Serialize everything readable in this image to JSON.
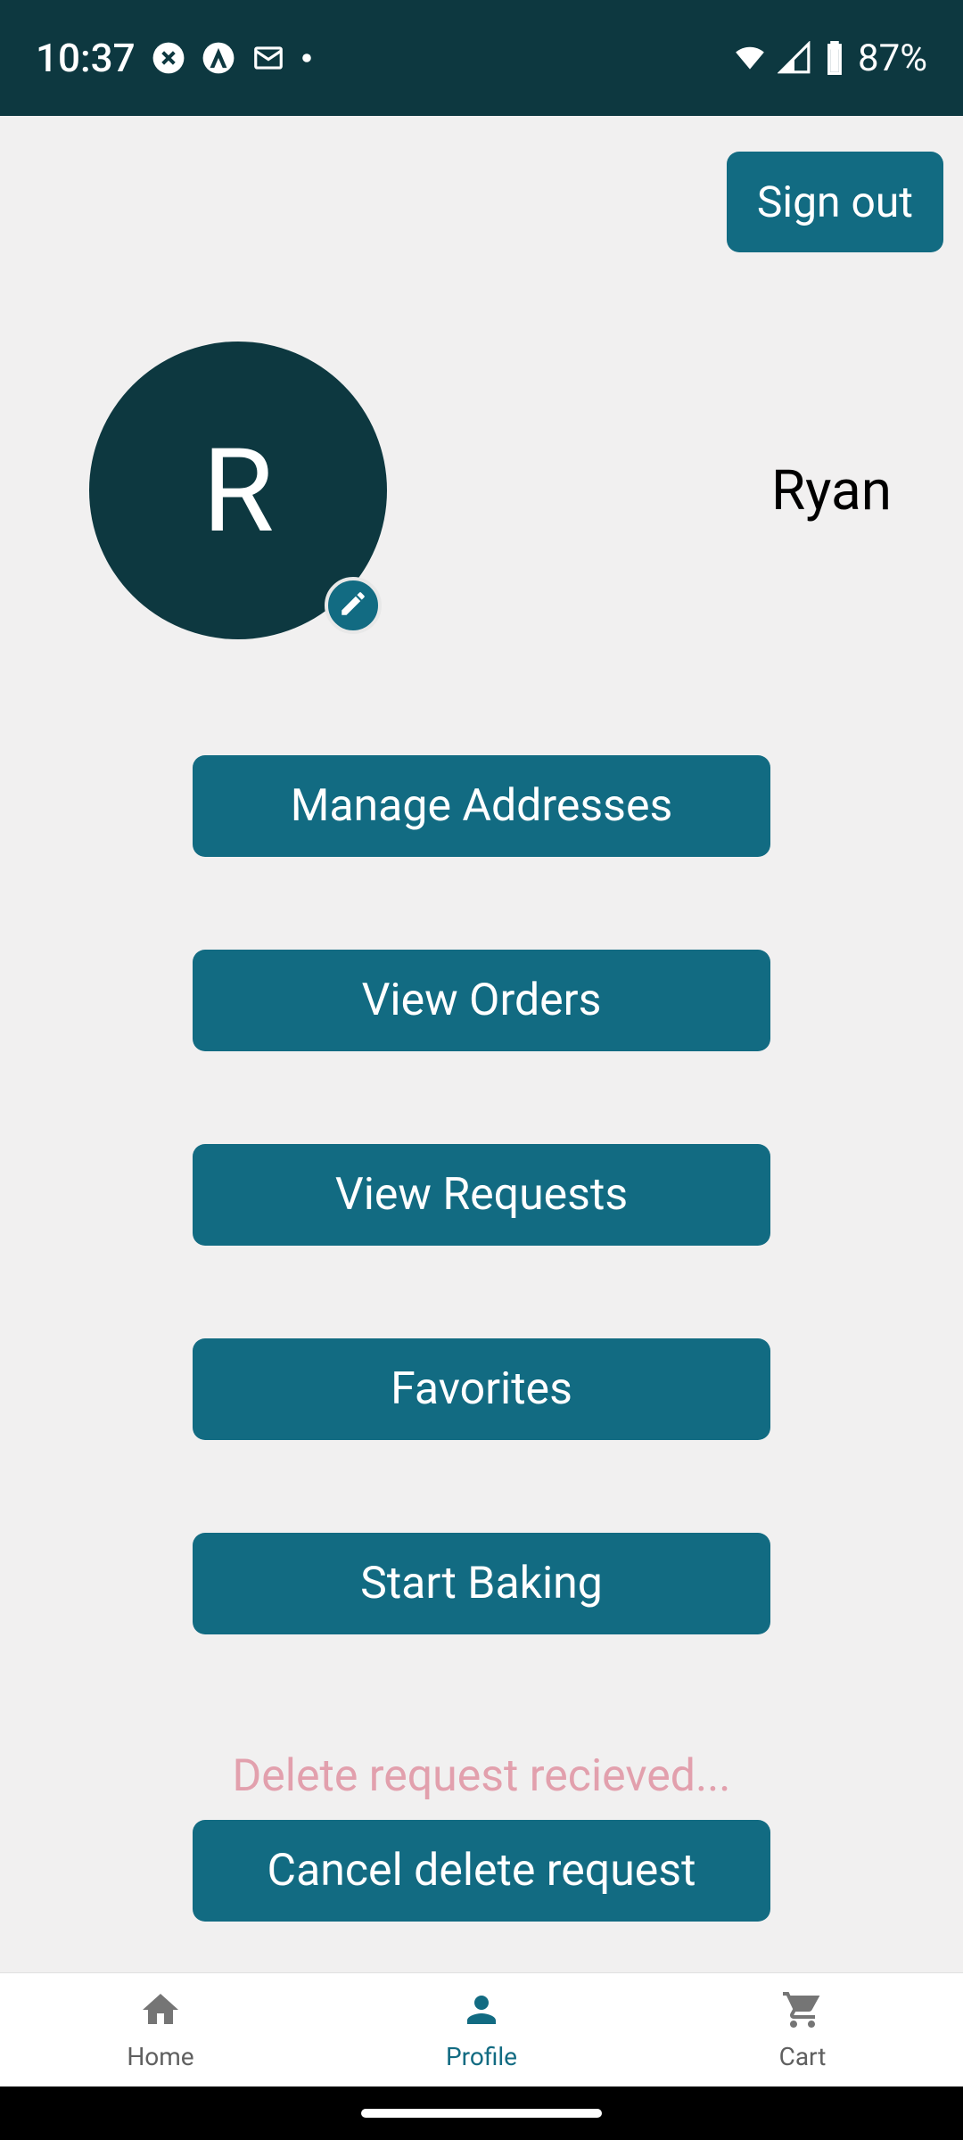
{
  "status_bar": {
    "time": "10:37",
    "battery": "87%"
  },
  "header": {
    "signout_label": "Sign out"
  },
  "profile": {
    "avatar_initial": "R",
    "name": "Ryan"
  },
  "actions": {
    "manage_addresses": "Manage Addresses",
    "view_orders": "View Orders",
    "view_requests": "View Requests",
    "favorites": "Favorites",
    "start_baking": "Start Baking"
  },
  "delete": {
    "status_text": "Delete request recieved...",
    "cancel_label": "Cancel delete request"
  },
  "bottom_nav": {
    "home": "Home",
    "profile": "Profile",
    "cart": "Cart"
  },
  "colors": {
    "accent": "#126b82",
    "avatar_bg": "#0d3840",
    "page_bg": "#f1f0f0",
    "delete_text": "#e2a0ad"
  }
}
